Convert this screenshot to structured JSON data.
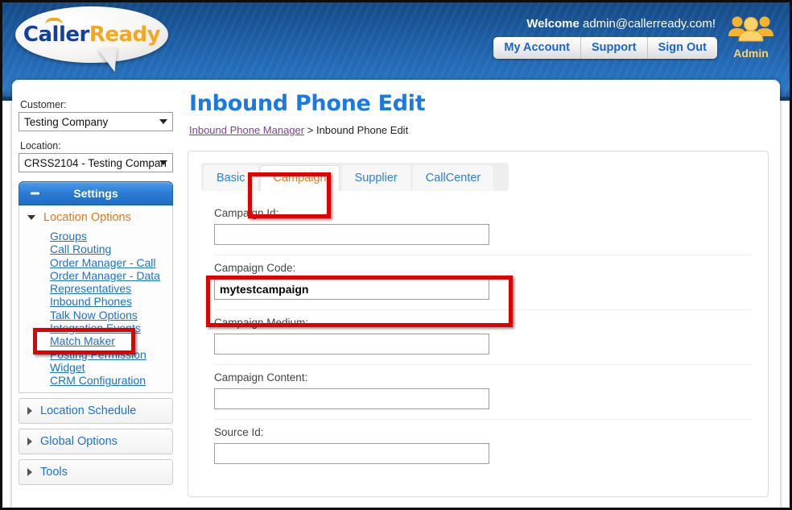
{
  "header": {
    "logo": {
      "part1": "Caller",
      "part2": "Ready",
      "icon": "phone-handset-icon"
    },
    "welcome_prefix": "Welcome",
    "welcome_user": "admin@callerready.com!",
    "nav": [
      {
        "label": "My Account"
      },
      {
        "label": "Support"
      },
      {
        "label": "Sign Out"
      }
    ],
    "admin": {
      "label": "Admin",
      "icon": "users-group-icon"
    },
    "colors": {
      "blue_dark": "#154a85",
      "blue_light": "#2a77c6",
      "link_blue": "#1565d8",
      "gold": "#ffd36b"
    }
  },
  "sidebar": {
    "customer_label": "Customer:",
    "customer_value": "Testing Company",
    "location_label": "Location:",
    "location_value": "CRSS2104 - Testing Compan",
    "settings_button": "Settings",
    "sections": [
      {
        "title": "Location Options",
        "state": "open",
        "links": [
          "Groups",
          "Call Routing",
          "Order Manager - Call",
          "Order Manager - Data",
          "Representatives",
          "Inbound Phones",
          "Talk Now Options",
          "Integration Events",
          "Match Maker",
          "Posting Permission",
          "Widget",
          "CRM Configuration"
        ]
      },
      {
        "title": "Location Schedule",
        "state": "closed",
        "links": []
      },
      {
        "title": "Global Options",
        "state": "closed",
        "links": []
      },
      {
        "title": "Tools",
        "state": "closed",
        "links": []
      }
    ]
  },
  "main": {
    "page_title": "Inbound Phone Edit",
    "breadcrumb": {
      "link": "Inbound Phone Manager",
      "separator": ">",
      "current": "Inbound Phone Edit"
    },
    "tabs": [
      {
        "label": "Basic",
        "active": false
      },
      {
        "label": "Campaign",
        "active": true
      },
      {
        "label": "Supplier",
        "active": false
      },
      {
        "label": "CallCenter",
        "active": false
      }
    ],
    "fields": [
      {
        "label": "Campaign Id:",
        "value": "",
        "bold": false
      },
      {
        "label": "Campaign Code:",
        "value": "mytestcampaign",
        "bold": true
      },
      {
        "label": "Campaign Medium:",
        "value": "",
        "bold": false
      },
      {
        "label": "Campaign Content:",
        "value": "",
        "bold": false
      },
      {
        "label": "Source Id:",
        "value": "",
        "bold": false
      }
    ]
  },
  "annotations": {
    "color": "#e00000",
    "boxes": [
      {
        "target": "campaign-tab"
      },
      {
        "target": "campaign-code-field"
      },
      {
        "target": "inbound-phones-link"
      }
    ]
  }
}
